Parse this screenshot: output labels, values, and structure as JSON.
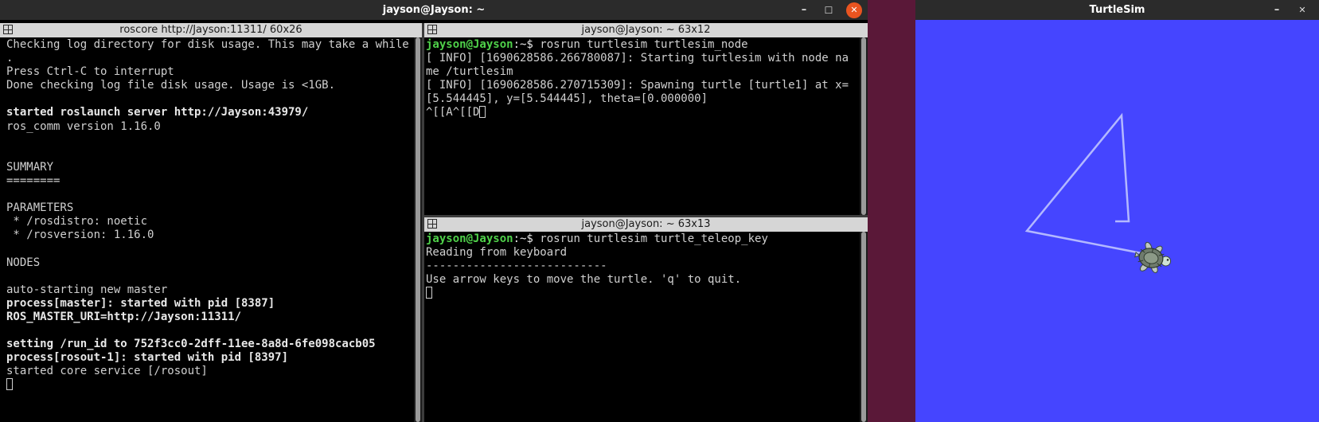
{
  "terminal_window": {
    "title": "jayson@Jayson: ~"
  },
  "pane_left": {
    "title": "roscore http://Jayson:11311/ 60x26",
    "lines": [
      "Checking log directory for disk usage. This may take a while",
      ".",
      "Press Ctrl-C to interrupt",
      "Done checking log file disk usage. Usage is <1GB.",
      "",
      "started roslaunch server http://Jayson:43979/",
      "ros_comm version 1.16.0",
      "",
      "",
      "SUMMARY",
      "========",
      "",
      "PARAMETERS",
      " * /rosdistro: noetic",
      " * /rosversion: 1.16.0",
      "",
      "NODES",
      "",
      "auto-starting new master",
      "process[master]: started with pid [8387]",
      "ROS_MASTER_URI=http://Jayson:11311/",
      "",
      "setting /run_id to 752f3cc0-2dff-11ee-8a8d-6fe098cacb05",
      "process[rosout-1]: started with pid [8397]",
      "started core service [/rosout]"
    ]
  },
  "pane_top_right": {
    "title": "jayson@Jayson: ~ 63x12",
    "prompt_user": "jayson@Jayson",
    "prompt_path": ":~$ ",
    "command": "rosrun turtlesim turtlesim_node",
    "lines": [
      "[ INFO] [1690628586.266780087]: Starting turtlesim with node na",
      "me /turtlesim",
      "[ INFO] [1690628586.270715309]: Spawning turtle [turtle1] at x=",
      "[5.544445], y=[5.544445], theta=[0.000000]"
    ],
    "input_text": "^[[A^[[D"
  },
  "pane_bottom_right": {
    "title": "jayson@Jayson: ~ 63x13",
    "prompt_user": "jayson@Jayson",
    "prompt_path": ":~$ ",
    "command": "rosrun turtlesim turtle_teleop_key",
    "lines": [
      "Reading from keyboard",
      "---------------------------",
      "Use arrow keys to move the turtle. 'q' to quit."
    ]
  },
  "turtlesim_window": {
    "title": "TurtleSim",
    "canvas_color": "#4545ff",
    "pen_color": "#b3b8ff",
    "path_points": [
      [
        0.827,
        0.388
      ],
      [
        0.835,
        0.555
      ],
      [
        0.829,
        0.555
      ],
      [
        0.829,
        0.525
      ],
      [
        0.782,
        0.525
      ],
      [
        0.846,
        0.55
      ],
      [
        0.859,
        0.534
      ]
    ]
  },
  "window_controls": {
    "minimize": "–",
    "maximize": "☐",
    "close": "✕"
  }
}
